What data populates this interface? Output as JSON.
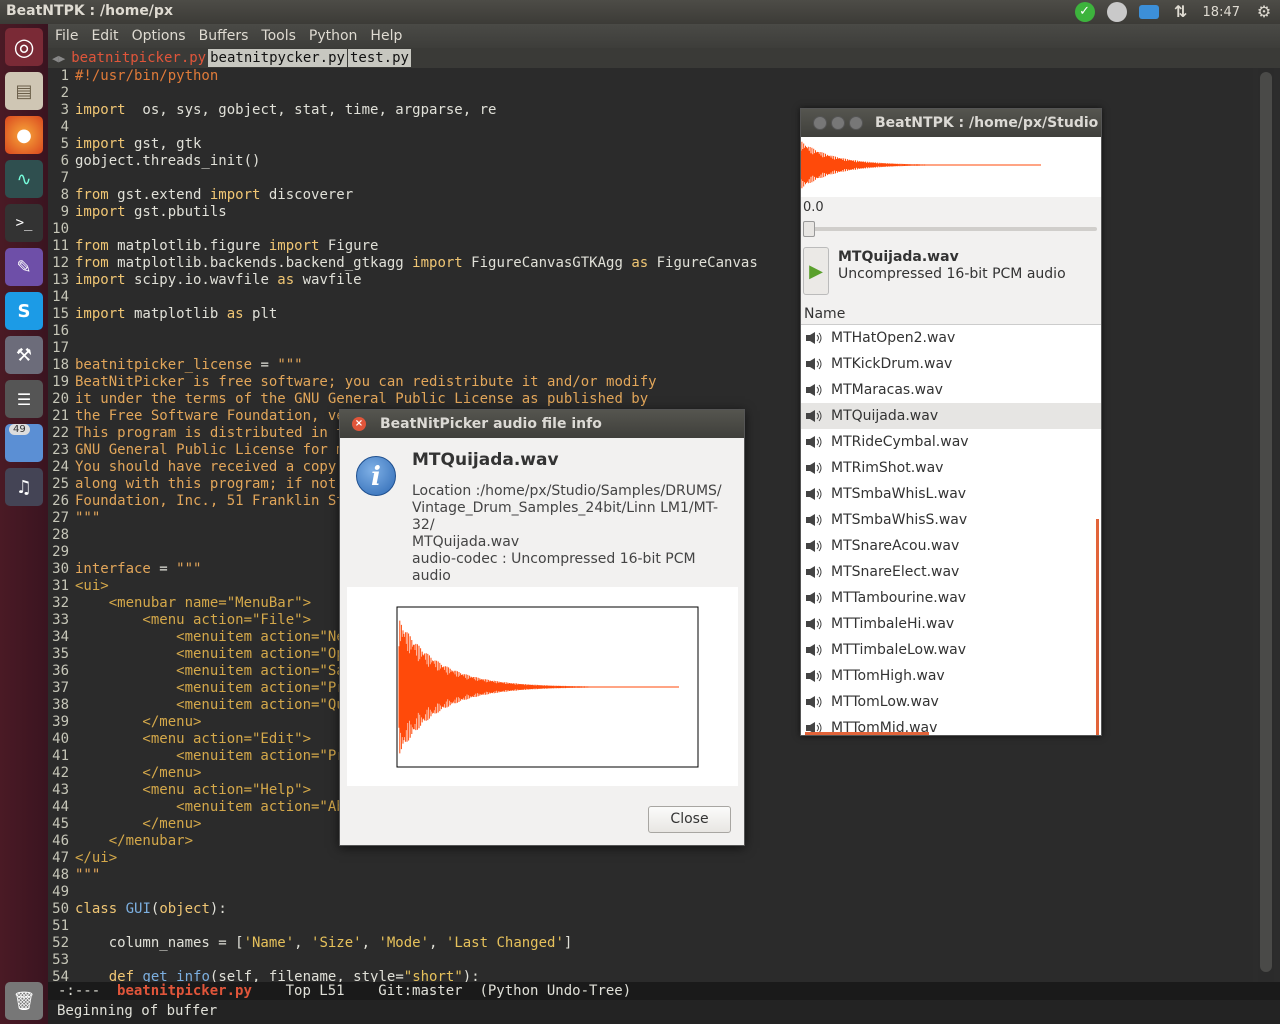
{
  "topbar": {
    "title": "BeatNTPK : /home/px",
    "clock": "18:47"
  },
  "launcher": {
    "badge": "49"
  },
  "menubar": [
    "File",
    "Edit",
    "Options",
    "Buffers",
    "Tools",
    "Python",
    "Help"
  ],
  "tabs": [
    "beatnitpicker.py",
    "beatnitpycker.py",
    "test.py"
  ],
  "code_lines": [
    [
      [
        "cm",
        "#!/usr/bin/python"
      ]
    ],
    [],
    [
      [
        "kw",
        "import"
      ],
      [
        "",
        "  os, sys, gobject, stat, time, argparse, re"
      ]
    ],
    [],
    [
      [
        "kw",
        "import"
      ],
      [
        "",
        " gst, gtk"
      ]
    ],
    [
      [
        "",
        "gobject.threads_init()"
      ]
    ],
    [],
    [
      [
        "kw",
        "from"
      ],
      [
        "",
        " gst.extend "
      ],
      [
        "kw",
        "import"
      ],
      [
        "",
        " discoverer"
      ]
    ],
    [
      [
        "kw",
        "import"
      ],
      [
        "",
        " gst.pbutils"
      ]
    ],
    [],
    [
      [
        "kw",
        "from"
      ],
      [
        "",
        " matplotlib.figure "
      ],
      [
        "kw",
        "import"
      ],
      [
        "",
        " Figure"
      ]
    ],
    [
      [
        "kw",
        "from"
      ],
      [
        "",
        " matplotlib.backends.backend_gtkagg "
      ],
      [
        "kw",
        "import"
      ],
      [
        "",
        " FigureCanvasGTKAgg "
      ],
      [
        "kw",
        "as"
      ],
      [
        "",
        " FigureCanvas"
      ]
    ],
    [
      [
        "kw",
        "import"
      ],
      [
        "",
        " scipy.io.wavfile "
      ],
      [
        "kw",
        "as"
      ],
      [
        "",
        " wavfile"
      ]
    ],
    [],
    [
      [
        "kw",
        "import"
      ],
      [
        "",
        " matplotlib "
      ],
      [
        "kw",
        "as"
      ],
      [
        "",
        " plt"
      ]
    ],
    [],
    [],
    [
      [
        "ds",
        "beatnitpicker_license"
      ],
      [
        "",
        " = "
      ],
      [
        "ds",
        "\"\"\""
      ]
    ],
    [
      [
        "ds",
        "BeatNitPicker is free software; you can redistribute it and/or modify"
      ]
    ],
    [
      [
        "ds",
        "it under the terms of the GNU General Public License as published by"
      ]
    ],
    [
      [
        "ds",
        "the Free Software Foundation, version 3 of the License."
      ]
    ],
    [
      [
        "ds",
        "This program is distributed in the hope that it will be useful,"
      ]
    ],
    [
      [
        "ds",
        "GNU General Public License for more details."
      ]
    ],
    [
      [
        "ds",
        "You should have received a copy of the GNU General Public License"
      ]
    ],
    [
      [
        "ds",
        "along with this program; if not, write to the Free Software"
      ]
    ],
    [
      [
        "ds",
        "Foundation, Inc., 51 Franklin Street, Fifth Floor, Boston, MA"
      ]
    ],
    [
      [
        "ds",
        "\"\"\""
      ]
    ],
    [],
    [],
    [
      [
        "ds",
        "interface"
      ],
      [
        "",
        " = "
      ],
      [
        "ds",
        "\"\"\""
      ]
    ],
    [
      [
        "tag",
        "<ui>"
      ]
    ],
    [
      [
        "tag",
        "    <menubar name=\"MenuBar\">"
      ]
    ],
    [
      [
        "tag",
        "        <menu action=\"File\">"
      ]
    ],
    [
      [
        "tag",
        "            <menuitem action=\"New\"/>"
      ]
    ],
    [
      [
        "tag",
        "            <menuitem action=\"Open\"/>"
      ]
    ],
    [
      [
        "tag",
        "            <menuitem action=\"Save\"/>"
      ]
    ],
    [
      [
        "tag",
        "            <menuitem action=\"Prefs\"/>"
      ]
    ],
    [
      [
        "tag",
        "            <menuitem action=\"Quit\"/>"
      ]
    ],
    [
      [
        "tag",
        "        </menu>"
      ]
    ],
    [
      [
        "tag",
        "        <menu action=\"Edit\">"
      ]
    ],
    [
      [
        "tag",
        "            <menuitem action=\"Prefs\"/>"
      ]
    ],
    [
      [
        "tag",
        "        </menu>"
      ]
    ],
    [
      [
        "tag",
        "        <menu action=\"Help\">"
      ]
    ],
    [
      [
        "tag",
        "            <menuitem action=\"About\"/>"
      ]
    ],
    [
      [
        "tag",
        "        </menu>"
      ]
    ],
    [
      [
        "tag",
        "    </menubar>"
      ]
    ],
    [
      [
        "tag",
        "</ui>"
      ]
    ],
    [
      [
        "ds",
        "\"\"\""
      ]
    ],
    [],
    [
      [
        "kw",
        "class"
      ],
      [
        "",
        " "
      ],
      [
        "fn",
        "GUI"
      ],
      [
        "",
        "("
      ],
      [
        "kw",
        "object"
      ],
      [
        "",
        "):"
      ]
    ],
    [],
    [
      [
        "",
        "    column_names = ["
      ],
      [
        "st",
        "'Name'"
      ],
      [
        ", ",
        ""
      ],
      [
        "",
        ", "
      ],
      [
        "st",
        "'Size'"
      ],
      [
        "",
        ", "
      ],
      [
        "st",
        "'Mode'"
      ],
      [
        "",
        ", "
      ],
      [
        "st",
        "'Last Changed'"
      ],
      [
        "",
        "]"
      ]
    ],
    [],
    [
      [
        "",
        "    "
      ],
      [
        "kw",
        "def"
      ],
      [
        "",
        " "
      ],
      [
        "fn",
        "get_info"
      ],
      [
        "",
        "(self, filename, style="
      ],
      [
        "st",
        "\"short\""
      ],
      [
        "",
        "):"
      ]
    ]
  ],
  "modeline": {
    "prefix": "-:---  ",
    "buffer": "beatnitpicker.py",
    "rest": "    Top L51    Git:master  (Python Undo-Tree)"
  },
  "minibuffer": "Beginning of buffer",
  "player": {
    "title": "BeatNTPK : /home/px/Studio",
    "position": "0.0",
    "file_name": "MTQuijada.wav",
    "codec": "Uncompressed 16-bit PCM audio",
    "column_header": "Name",
    "files": [
      "MTHatOpen2.wav",
      "MTKickDrum.wav",
      "MTMaracas.wav",
      "MTQuijada.wav",
      "MTRideCymbal.wav",
      "MTRimShot.wav",
      "MTSmbaWhisL.wav",
      "MTSmbaWhisS.wav",
      "MTSnareAcou.wav",
      "MTSnareElect.wav",
      "MTTambourine.wav",
      "MTTimbaleHi.wav",
      "MTTimbaleLow.wav",
      "MTTomHigh.wav",
      "MTTomLow.wav",
      "MTTomMid.wav"
    ],
    "selected_index": 3
  },
  "dialog": {
    "title": "BeatNitPicker audio file info",
    "file_name": "MTQuijada.wav",
    "location_line1": "Location :/home/px/Studio/Samples/DRUMS/",
    "location_line2": "Vintage_Drum_Samples_24bit/Linn LM1/MT-32/",
    "location_line3": "MTQuijada.wav",
    "codec_line": "audio-codec : Uncompressed 16-bit PCM audio",
    "close_label": "Close"
  },
  "colors": {
    "waveform": "#ff4a0a",
    "accent": "#e2643a"
  }
}
